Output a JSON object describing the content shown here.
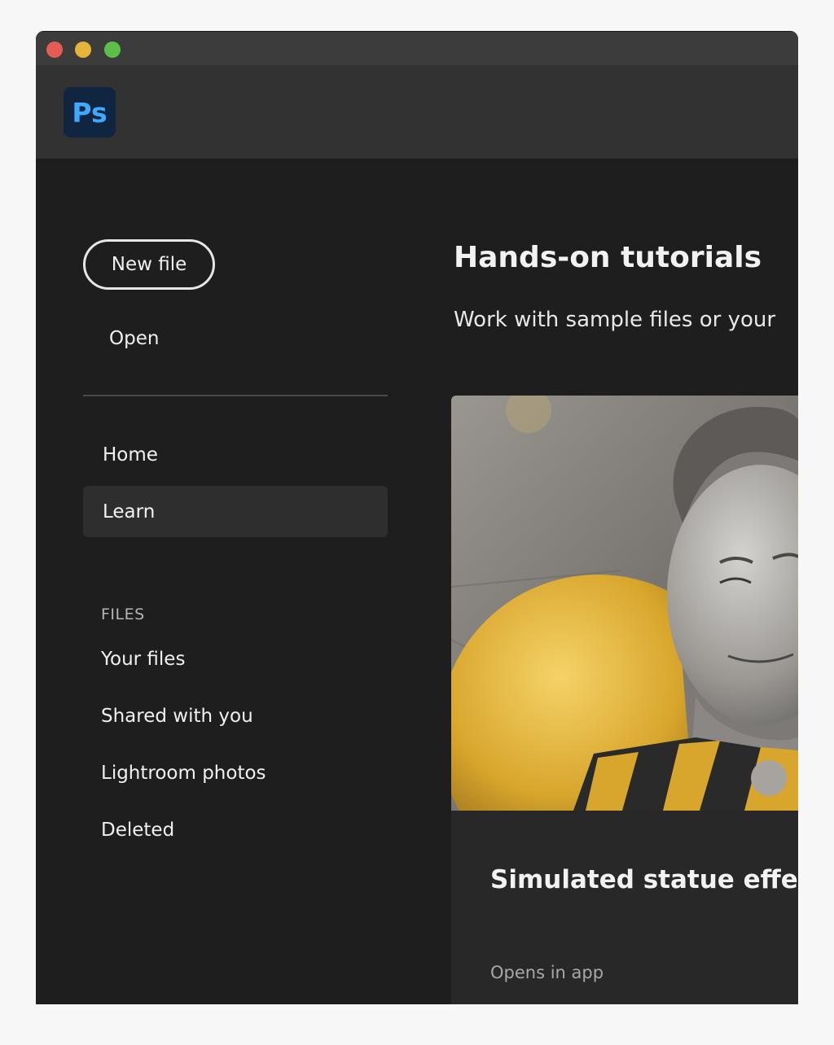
{
  "app": {
    "logo_text": "Ps"
  },
  "sidebar": {
    "new_file_label": "New file",
    "open_label": "Open",
    "nav": [
      {
        "label": "Home",
        "active": false
      },
      {
        "label": "Learn",
        "active": true
      }
    ],
    "files_section_label": "FILES",
    "files": [
      {
        "label": "Your files"
      },
      {
        "label": "Shared with you"
      },
      {
        "label": "Lightroom photos"
      },
      {
        "label": "Deleted"
      }
    ]
  },
  "main": {
    "title": "Hands-on tutorials",
    "subtitle": "Work with sample files or your",
    "card": {
      "title": "Simulated statue effect",
      "meta": "Opens in app"
    }
  },
  "colors": {
    "background": "#1e1e1e",
    "header": "#323232",
    "ps_logo_bg": "#0f2540",
    "ps_logo_fg": "#3fa8ff",
    "active_nav": "#2e2e2e"
  }
}
